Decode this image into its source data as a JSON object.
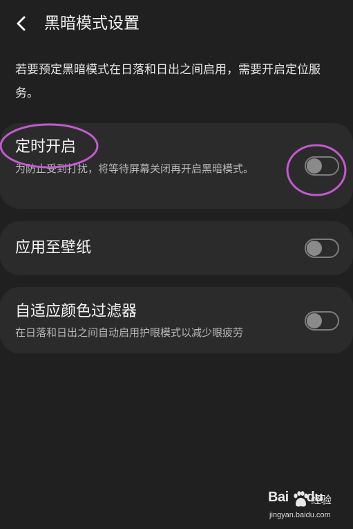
{
  "header": {
    "title": "黑暗模式设置"
  },
  "notice": "若要预定黑暗模式在日落和日出之间启用，需要开启定位服务。",
  "settings": [
    {
      "title": "定时开启",
      "description": "为防止受到打扰，将等待屏幕关闭再开启黑暗模式。",
      "enabled": false
    },
    {
      "title": "应用至壁纸",
      "enabled": false
    },
    {
      "title": "自适应颜色过滤器",
      "description": "在日落和日出之间自动启用护眼模式以减少眼疲劳",
      "enabled": false
    }
  ],
  "annotation_color": "#c35ad0",
  "watermark": {
    "brand_bai": "Bai",
    "brand_du": "du",
    "brand_jingyan": "经验",
    "url": "jingyan.baidu.com"
  },
  "icons": {
    "back": "chevron-left-icon"
  }
}
